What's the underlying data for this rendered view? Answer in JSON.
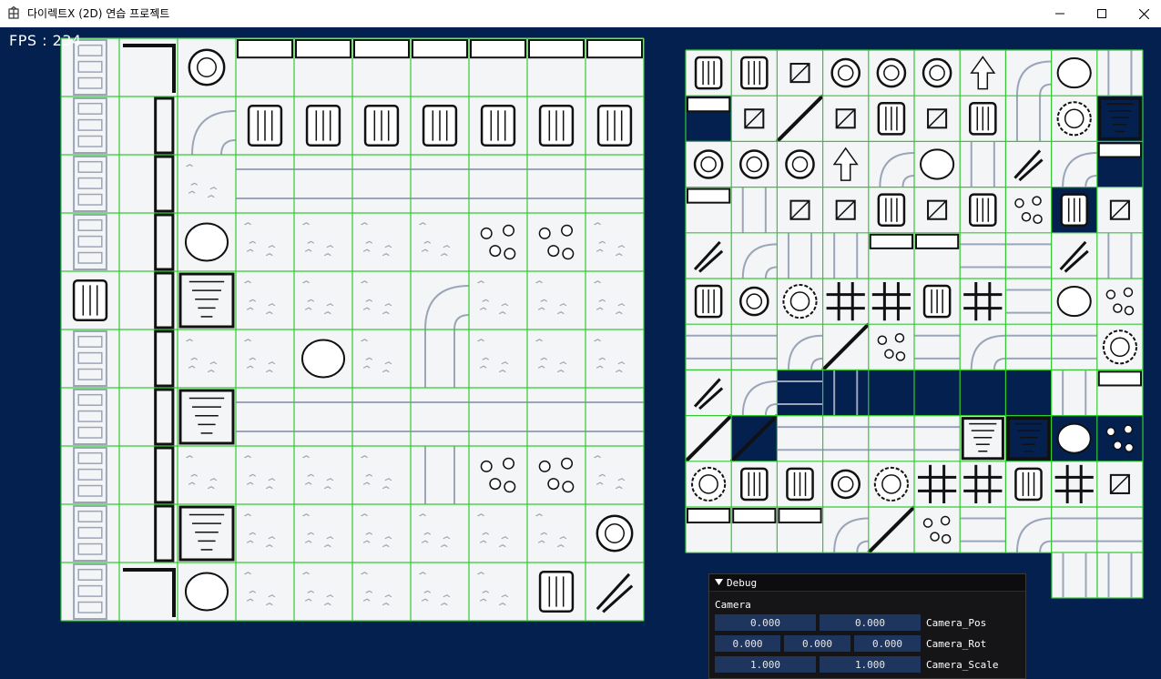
{
  "window": {
    "title": "다이렉트X (2D) 연습 프로젝트",
    "minimize_glyph": "—",
    "maximize_glyph": "☐",
    "close_glyph": "✕"
  },
  "hud": {
    "fps": "FPS : 234"
  },
  "debug": {
    "header": "Debug",
    "section": "Camera",
    "rows": [
      {
        "label": "Camera_Pos",
        "values": [
          "0.000",
          "0.000"
        ]
      },
      {
        "label": "Camera_Rot",
        "values": [
          "0.000",
          "0.000",
          "0.000"
        ]
      },
      {
        "label": "Camera_Scale",
        "values": [
          "1.000",
          "1.000"
        ]
      }
    ]
  },
  "colors": {
    "background": "#04204f",
    "grid_line": "#33c933",
    "tile_fill": "#f4f5f7",
    "tile_line": "#9aa6b8",
    "ink": "#111111"
  }
}
